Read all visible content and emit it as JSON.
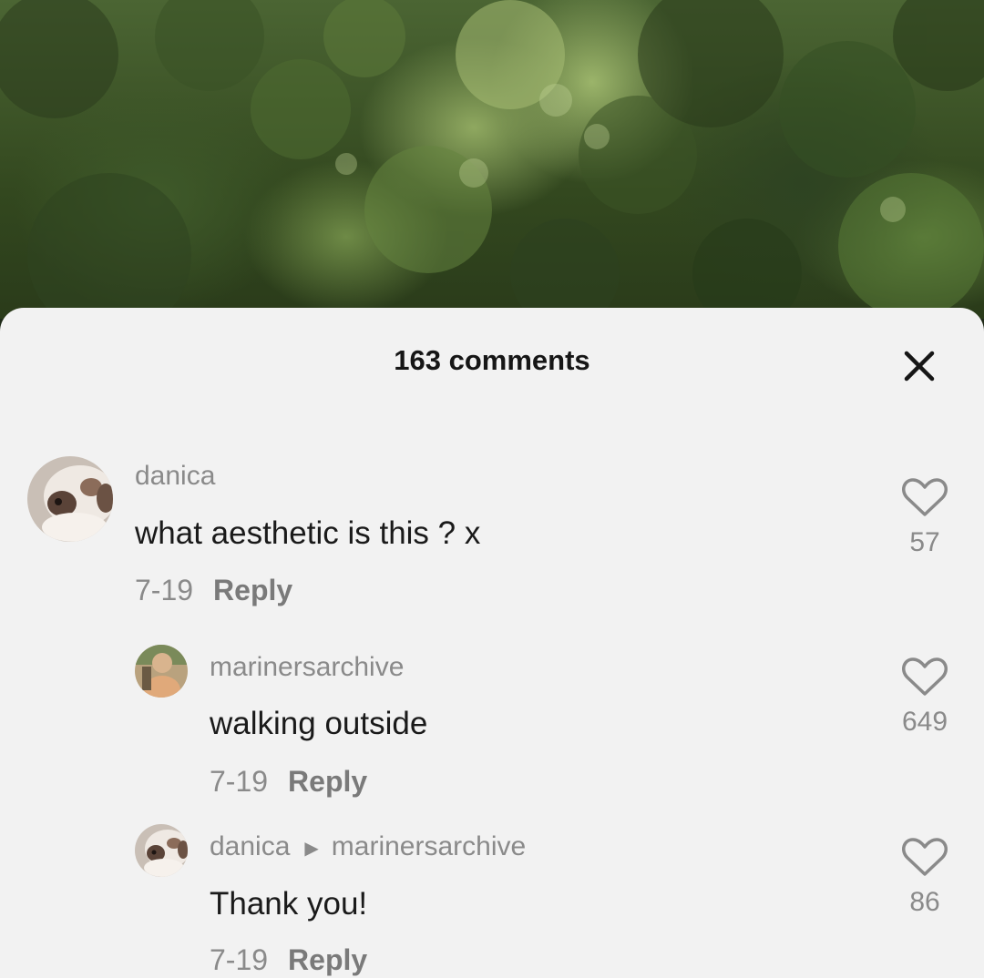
{
  "sheet": {
    "title": "163 comments",
    "close_icon": "close-icon"
  },
  "comments": [
    {
      "username": "danica",
      "text": "what aesthetic is this ? x",
      "date": "7-19",
      "reply_label": "Reply",
      "likes": "57",
      "avatar": "cat-avatar"
    },
    {
      "username": "marinersarchive",
      "text": "walking outside",
      "date": "7-19",
      "reply_label": "Reply",
      "likes": "649",
      "avatar": "person-avatar"
    },
    {
      "username": "danica",
      "reply_to": "marinersarchive",
      "text": "Thank you!",
      "date": "7-19",
      "reply_label": "Reply",
      "likes": "86",
      "avatar": "cat-avatar"
    }
  ],
  "colors": {
    "sheet_bg": "#f2f2f2",
    "muted_text": "#8a8a8a",
    "primary_text": "#1a1a1a"
  }
}
